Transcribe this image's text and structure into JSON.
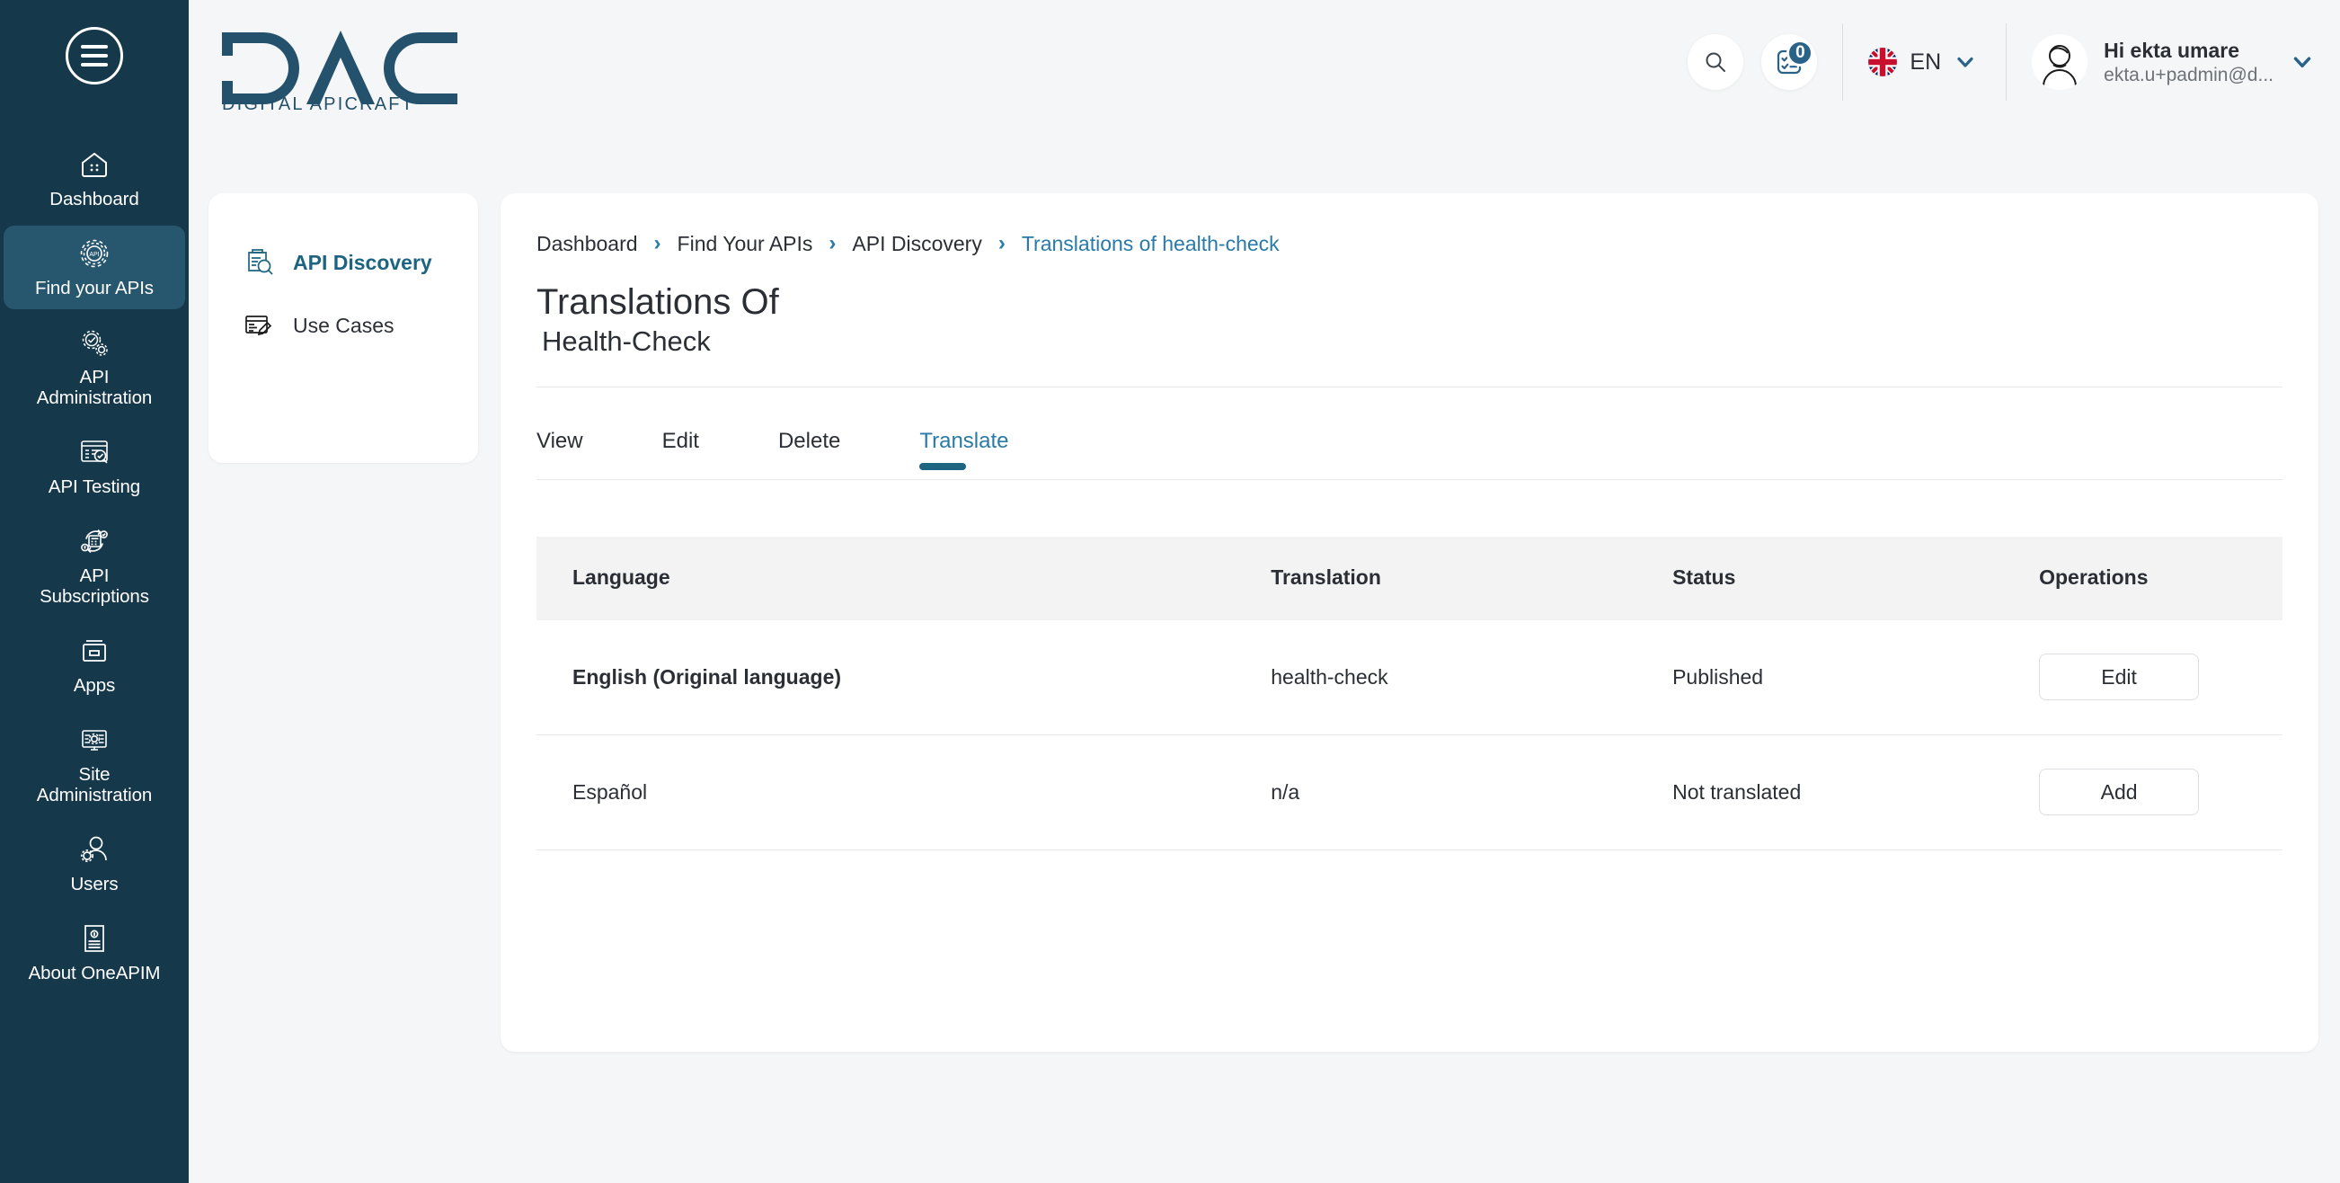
{
  "sidebar": {
    "menu_icon": "hamburger-menu-icon",
    "items": [
      {
        "label": "Dashboard",
        "icon": "dashboard-home-icon",
        "active": false
      },
      {
        "label": "Find your APIs",
        "icon": "api-gear-icon",
        "active": true
      },
      {
        "label": "API\nAdministration",
        "icon": "api-admin-gears-icon",
        "active": false
      },
      {
        "label": "API Testing",
        "icon": "api-testing-magnifier-icon",
        "active": false
      },
      {
        "label": "API\nSubscriptions",
        "icon": "api-subscriptions-cycle-icon",
        "active": false
      },
      {
        "label": "Apps",
        "icon": "apps-archive-icon",
        "active": false
      },
      {
        "label": "Site\nAdministration",
        "icon": "site-admin-monitor-icon",
        "active": false
      },
      {
        "label": "Users",
        "icon": "users-person-gear-icon",
        "active": false
      },
      {
        "label": "About OneAPIM",
        "icon": "about-document-info-icon",
        "active": false
      }
    ]
  },
  "header": {
    "logo_title": "DAC",
    "logo_subtitle": "DIGITAL APICRAFT",
    "search_icon": "search-icon",
    "notifications_icon": "tasks-checklist-icon",
    "notifications_count": "0",
    "language": {
      "flag": "uk-flag-icon",
      "code": "EN",
      "chevron": "chevron-down-icon"
    },
    "user": {
      "avatar": "user-avatar-icon",
      "greeting": "Hi ekta umare",
      "email": "ekta.u+padmin@d...",
      "chevron": "chevron-down-icon"
    }
  },
  "subnav": {
    "items": [
      {
        "label": "API Discovery",
        "icon": "api-discovery-icon",
        "active": true
      },
      {
        "label": "Use Cases",
        "icon": "use-cases-pencil-icon",
        "active": false
      }
    ]
  },
  "main": {
    "breadcrumb": [
      {
        "label": "Dashboard",
        "current": false
      },
      {
        "label": "Find Your APIs",
        "current": false
      },
      {
        "label": "API Discovery",
        "current": false
      },
      {
        "label": "Translations of health-check",
        "current": true
      }
    ],
    "breadcrumb_separator": "›",
    "title_line1": "Translations Of",
    "title_line2": "Health-Check",
    "tabs": [
      {
        "label": "View",
        "active": false
      },
      {
        "label": "Edit",
        "active": false
      },
      {
        "label": "Delete",
        "active": false
      },
      {
        "label": "Translate",
        "active": true
      }
    ],
    "table": {
      "columns": [
        "Language",
        "Translation",
        "Status",
        "Operations"
      ],
      "rows": [
        {
          "language": "English (Original language)",
          "language_bold": true,
          "translation": "health-check",
          "status": "Published",
          "operation": "Edit"
        },
        {
          "language": "Español",
          "language_bold": false,
          "translation": "n/a",
          "status": "Not translated",
          "operation": "Add"
        }
      ]
    }
  },
  "colors": {
    "sidebar_bg": "#16384b",
    "sidebar_active": "#27566f",
    "accent": "#2a7aa8",
    "accent_dark": "#1d6480",
    "page_bg": "#f5f6f7",
    "text": "#2b2f35",
    "muted": "#6d7278",
    "table_header_bg": "#f3f3f3",
    "border": "#e6e8ea"
  }
}
